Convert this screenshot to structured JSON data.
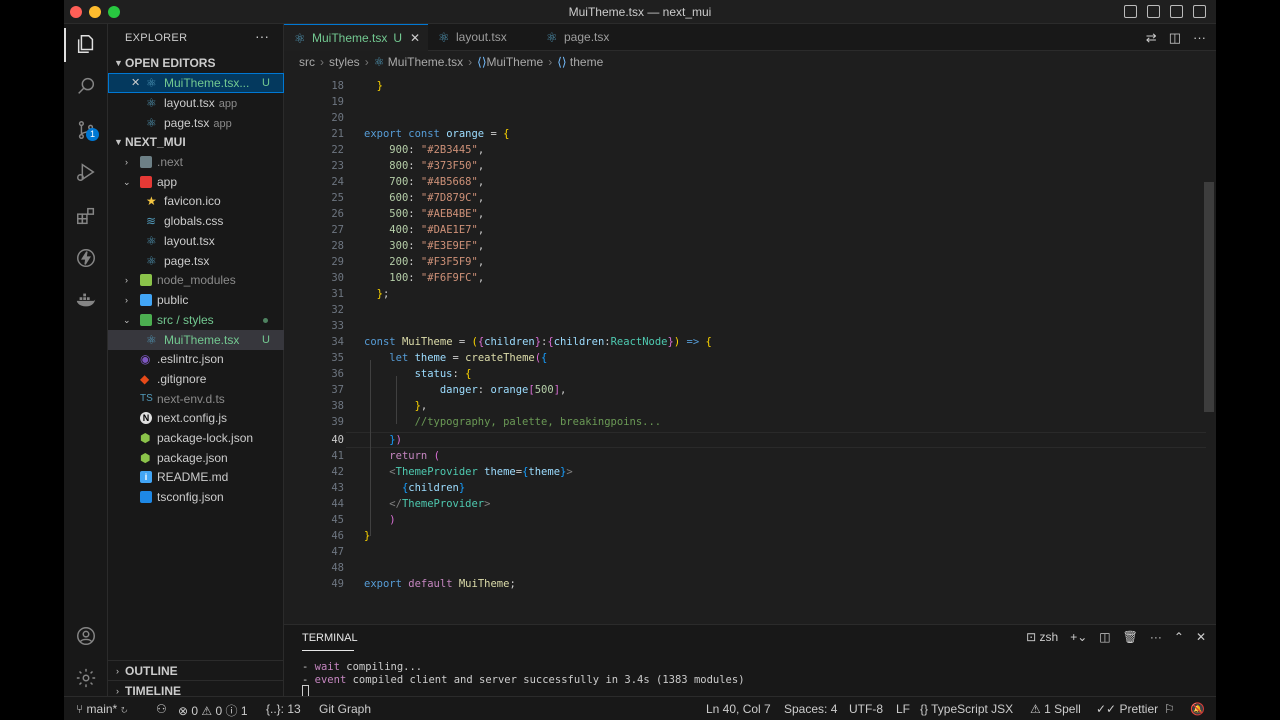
{
  "window": {
    "title": "MuiTheme.tsx — next_mui"
  },
  "activity_bar": {
    "items": [
      "explorer-icon",
      "search-icon",
      "source-control-icon",
      "run-debug-icon",
      "extensions-icon",
      "thunder-icon",
      "docker-icon"
    ],
    "source_control_badge": "1",
    "bottom": [
      "account-icon",
      "settings-gear-icon"
    ]
  },
  "sidebar": {
    "header": "EXPLORER",
    "more": "···",
    "open_editors": {
      "title": "OPEN EDITORS",
      "items": [
        {
          "name": "MuiTheme.tsx...",
          "status": "U",
          "close": "✕"
        },
        {
          "name": "layout.tsx",
          "desc": "app"
        },
        {
          "name": "page.tsx",
          "desc": "app"
        }
      ]
    },
    "project": {
      "title": "NEXT_MUI",
      "items": [
        {
          "name": ".next"
        },
        {
          "name": "app"
        },
        {
          "name": "favicon.ico"
        },
        {
          "name": "globals.css"
        },
        {
          "name": "layout.tsx"
        },
        {
          "name": "page.tsx"
        },
        {
          "name": "node_modules"
        },
        {
          "name": "public"
        },
        {
          "name": "src / styles"
        },
        {
          "name": "MuiTheme.tsx",
          "status": "U"
        },
        {
          "name": ".eslintrc.json"
        },
        {
          "name": ".gitignore"
        },
        {
          "name": "next-env.d.ts"
        },
        {
          "name": "next.config.js"
        },
        {
          "name": "package-lock.json"
        },
        {
          "name": "package.json"
        },
        {
          "name": "README.md"
        },
        {
          "name": "tsconfig.json"
        }
      ]
    },
    "outline": "OUTLINE",
    "timeline": "TIMELINE"
  },
  "tabs": [
    {
      "label": "MuiTheme.tsx",
      "status": "U",
      "close": "✕"
    },
    {
      "label": "layout.tsx"
    },
    {
      "label": "page.tsx"
    }
  ],
  "breadcrumb": [
    "src",
    "styles",
    "MuiTheme.tsx",
    "MuiTheme",
    "theme"
  ],
  "editor": {
    "line_numbers": [
      "18",
      "19",
      "20",
      "21",
      "22",
      "23",
      "24",
      "25",
      "26",
      "27",
      "28",
      "29",
      "30",
      "31",
      "32",
      "33",
      "34",
      "35",
      "36",
      "37",
      "38",
      "39",
      "40",
      "41",
      "42",
      "43",
      "44",
      "45",
      "46",
      "47",
      "48",
      "49"
    ],
    "current_line": "40",
    "orange": [
      {
        "key": "900",
        "value": "\"#2B3445\""
      },
      {
        "key": "800",
        "value": "\"#373F50\""
      },
      {
        "key": "700",
        "value": "\"#4B5668\""
      },
      {
        "key": "600",
        "value": "\"#7D879C\""
      },
      {
        "key": "500",
        "value": "\"#AEB4BE\""
      },
      {
        "key": "400",
        "value": "\"#DAE1E7\""
      },
      {
        "key": "300",
        "value": "\"#E3E9EF\""
      },
      {
        "key": "200",
        "value": "\"#F3F5F9\""
      },
      {
        "key": "100",
        "value": "\"#F6F9FC\""
      }
    ],
    "comment": "//typography, palette, breakingpoins..."
  },
  "panel": {
    "title": "TERMINAL",
    "shell": "zsh",
    "lines": [
      {
        "dash": "- ",
        "kind": "wait",
        "text": " compiling..."
      },
      {
        "dash": "- ",
        "kind": "event",
        "text": " compiled client and server successfully in 3.4s (1383 modules)"
      }
    ]
  },
  "status_bar": {
    "branch": "main*",
    "errors": "0",
    "warnings": "0",
    "info": "1",
    "selector": "{..}: 13",
    "git_graph": "Git Graph",
    "position": "Ln 40, Col 7",
    "spaces": "Spaces: 4",
    "encoding": "UTF-8",
    "eol": "LF",
    "language": "TypeScript JSX",
    "spell": "1 Spell",
    "prettier": "Prettier"
  },
  "colors": {
    "accent": "#0078d4",
    "untracked": "#73c991",
    "tsx_icon": "#519aba"
  }
}
